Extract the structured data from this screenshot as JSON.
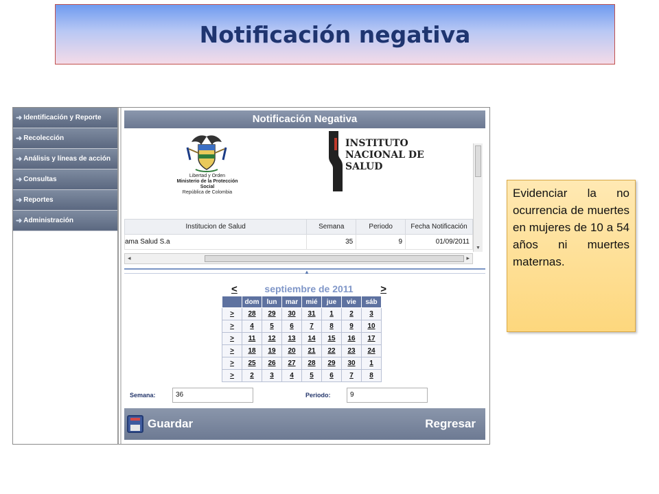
{
  "slide": {
    "title": "Notificación negativa",
    "note": "Evidenciar la no ocurrencia de muertes en mujeres de 10 a 54 años ni muertes maternas."
  },
  "sidebar": {
    "items": [
      {
        "label": "Identificación y Reporte",
        "icon": "arrow-right-icon"
      },
      {
        "label": "Recolección",
        "icon": "arrow-right-icon"
      },
      {
        "label": "Análisis y líneas de acción",
        "icon": "arrow-right-icon"
      },
      {
        "label": "Consultas",
        "icon": "arrow-right-icon"
      },
      {
        "label": "Reportes",
        "icon": "arrow-right-icon"
      },
      {
        "label": "Administración",
        "icon": "arrow-right-icon"
      }
    ]
  },
  "panel": {
    "title": "Notificación Negativa"
  },
  "logos": {
    "coat_line1": "Libertad y Orden",
    "coat_line2": "Ministerio de la Protección Social",
    "coat_line3": "República de Colombia",
    "ins_line1": "INSTITUTO",
    "ins_line2": "NACIONAL DE",
    "ins_line3": "SALUD"
  },
  "table": {
    "headers": [
      "Institucion de Salud",
      "Semana",
      "Periodo",
      "Fecha Notificación"
    ],
    "row": [
      "ama Salud S.a",
      "35",
      "9",
      "01/09/2011"
    ]
  },
  "calendar": {
    "prev": "<",
    "next": ">",
    "month": "septiembre de 2011",
    "days": [
      "dom",
      "lun",
      "mar",
      "mié",
      "jue",
      "vie",
      "sáb"
    ],
    "week_marker": ">",
    "weeks": [
      [
        "28",
        "29",
        "30",
        "31",
        "1",
        "2",
        "3"
      ],
      [
        "4",
        "5",
        "6",
        "7",
        "8",
        "9",
        "10"
      ],
      [
        "11",
        "12",
        "13",
        "14",
        "15",
        "16",
        "17"
      ],
      [
        "18",
        "19",
        "20",
        "21",
        "22",
        "23",
        "24"
      ],
      [
        "25",
        "26",
        "27",
        "28",
        "29",
        "30",
        "1"
      ],
      [
        "2",
        "3",
        "4",
        "5",
        "6",
        "7",
        "8"
      ]
    ]
  },
  "fields": {
    "semana_label": "Semana:",
    "semana_value": "36",
    "periodo_label": "Periodo:",
    "periodo_value": "9"
  },
  "footer": {
    "save_label": "Guardar",
    "save_icon": "save-disk-icon",
    "back_label": "Regresar"
  },
  "colors": {
    "title_text": "#1f3570",
    "banner_border": "#c0504d",
    "sidebar_bg": "#5b6880",
    "calendar_header": "#5e72a0",
    "note_bg": "#fdd77d"
  }
}
